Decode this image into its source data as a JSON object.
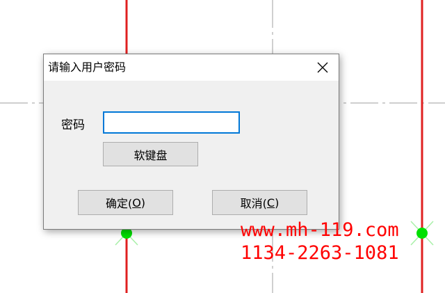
{
  "dialog": {
    "title": "请输入用户密码",
    "password_label": "密码",
    "password_value": "",
    "keyboard_button": "软键盘",
    "ok_button": {
      "prefix": "确定(",
      "hotkey": "O",
      "suffix": ")"
    },
    "cancel_button": {
      "prefix": "取消(",
      "hotkey": "C",
      "suffix": ")"
    }
  },
  "watermark": {
    "line1": "www.mh-119.com",
    "line2": "1134-2263-1081"
  },
  "colors": {
    "accent": "#0078d7",
    "cad_line_red": "#e02020",
    "cad_node_green": "#00e000",
    "watermark": "#ff0000",
    "dialog_bg": "#f0f0f0"
  },
  "icons": {
    "close": "close-icon"
  }
}
